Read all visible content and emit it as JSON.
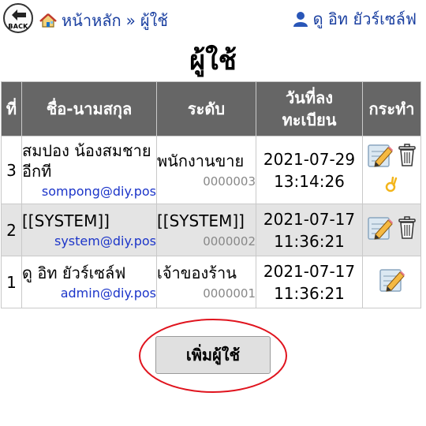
{
  "header": {
    "back_label": "BACK",
    "breadcrumb": {
      "home": "หน้าหลัก",
      "separator": "»",
      "current": "ผู้ใช้"
    },
    "user_name": "ดู อิท ยัวร์เซล์ฟ"
  },
  "page_title": "ผู้ใช้",
  "table": {
    "columns": [
      "ที่",
      "ชื่อ-นามสกุล",
      "ระดับ",
      "วันที่ลง\nทะเบียน",
      "กระทำ"
    ],
    "rows": [
      {
        "no": "3",
        "name": "สมปอง น้องสมชายอีกที",
        "email": "sompong@diy.pos",
        "level": "พนักงานขาย",
        "code": "0000003",
        "date": "2021-07-29",
        "time": "13:14:26",
        "actions": [
          "edit-icon",
          "trash-icon",
          "ok-hand-icon"
        ]
      },
      {
        "no": "2",
        "name": "[[SYSTEM]]",
        "email": "system@diy.pos",
        "level": "[[SYSTEM]]",
        "code": "0000002",
        "date": "2021-07-17",
        "time": "11:36:21",
        "actions": [
          "edit-icon",
          "trash-icon"
        ]
      },
      {
        "no": "1",
        "name": "ดู อิท ยัวร์เซล์ฟ",
        "email": "admin@diy.pos",
        "level": "เจ้าของร้าน",
        "code": "0000001",
        "date": "2021-07-17",
        "time": "11:36:21",
        "actions": [
          "edit-icon"
        ]
      }
    ]
  },
  "add_button": "เพิ่มผู้ใช้",
  "colors": {
    "link": "#1a3fa0",
    "email": "#1c35c9",
    "header_bg": "#666666",
    "alt_row": "#e4e4e4",
    "highlight_ellipse": "#e0141e"
  }
}
